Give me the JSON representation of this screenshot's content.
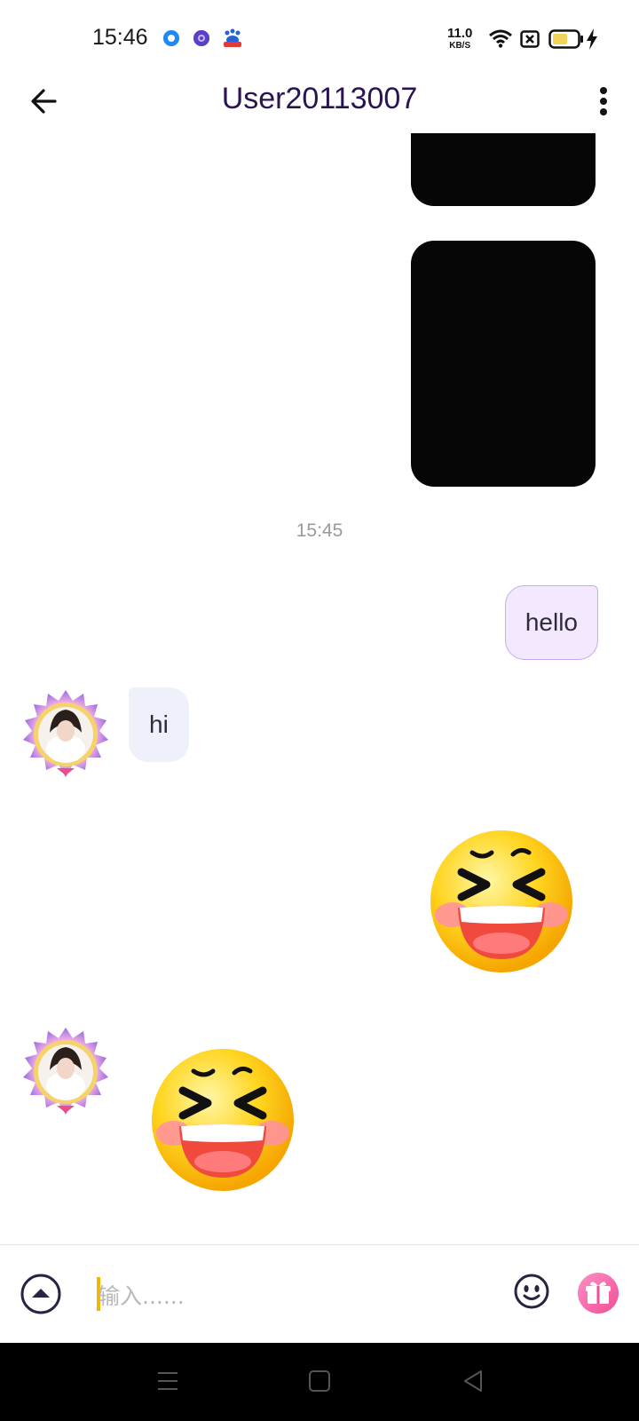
{
  "status_bar": {
    "time": "15:46",
    "net_speed": "11.0",
    "net_unit": "KB/S",
    "icons": [
      "app-notification-icon-blue",
      "app-notification-icon-purple",
      "baidu-notification-icon",
      "wifi-icon",
      "sim-blocked-icon",
      "battery-icon",
      "charging-icon"
    ]
  },
  "header": {
    "title": "User20113007",
    "back_icon": "arrow-left-icon",
    "menu_icon": "more-vertical-icon"
  },
  "messages": [
    {
      "direction": "outgoing",
      "type": "media"
    },
    {
      "direction": "outgoing",
      "type": "media"
    },
    {
      "type": "timestamp",
      "text": "15:45"
    },
    {
      "direction": "outgoing",
      "type": "text",
      "text": "hello"
    },
    {
      "direction": "incoming",
      "type": "text",
      "text": "hi"
    },
    {
      "direction": "outgoing",
      "type": "sticker",
      "sticker": "laughing-squint-emoji"
    },
    {
      "direction": "incoming",
      "type": "sticker",
      "sticker": "laughing-squint-emoji"
    }
  ],
  "input_bar": {
    "placeholder": "输入......",
    "expand_icon": "expand-up-icon",
    "emoji_icon": "emoji-icon",
    "gift_icon": "gift-icon"
  },
  "colors": {
    "accent_purple": "#2a1552",
    "outgoing_bubble": "#f3e8fd",
    "incoming_bubble": "#eef0fa",
    "gift_pink": "#f06ba8",
    "caret": "#f2b600"
  }
}
